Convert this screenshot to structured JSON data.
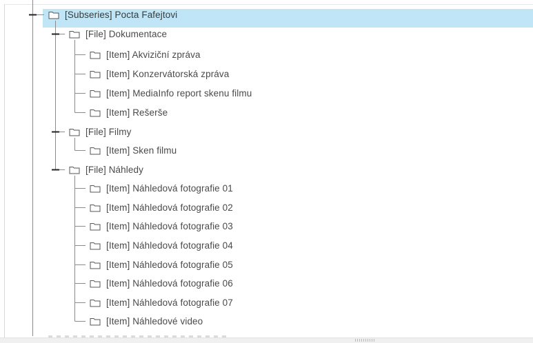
{
  "tree": {
    "subseries": {
      "label": "[Subseries] Pocta Fafejtovi",
      "selected": true,
      "expanded": true
    },
    "files": [
      {
        "label": "[File] Dokumentace",
        "expanded": true,
        "items": [
          "[Item] Akviziční zpráva",
          "[Item] Konzervátorská zpráva",
          "[Item] MediaInfo report skenu filmu",
          "[Item] Rešerše"
        ]
      },
      {
        "label": "[File] Filmy",
        "expanded": true,
        "items": [
          "[Item] Sken filmu"
        ]
      },
      {
        "label": "[File] Náhledy",
        "expanded": true,
        "items": [
          "[Item] Náhledová fotografie 01",
          "[Item] Náhledová fotografie 02",
          "[Item] Náhledová fotografie 03",
          "[Item] Náhledová fotografie 04",
          "[Item] Náhledová fotografie 05",
          "[Item] Náhledová fotografie 06",
          "[Item] Náhledová fotografie 07",
          "[Item] Náhledové video"
        ]
      }
    ]
  },
  "colors": {
    "selection": "#bfe5f7",
    "connector": "#8a8a8a",
    "folder_stroke": "#555555"
  }
}
